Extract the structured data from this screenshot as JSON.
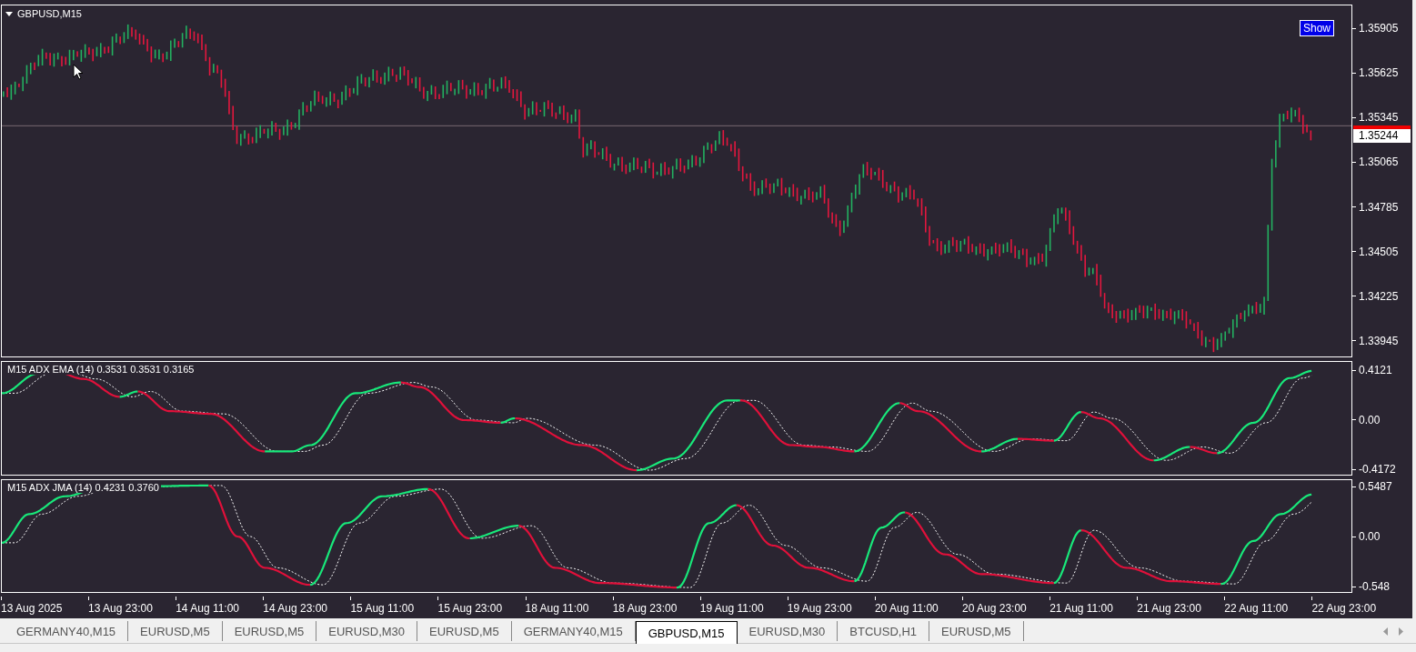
{
  "chart": {
    "title": "GBPUSD,M15",
    "show_button": "Show",
    "price_ticks": [
      "1.35905",
      "1.35625",
      "1.35345",
      "1.35065",
      "1.34785",
      "1.34505",
      "1.34225",
      "1.33945"
    ],
    "bid_label": "1.35244"
  },
  "indicators": [
    {
      "label": "M15 ADX EMA (14) 0.3531 0.3531 0.3165",
      "ticks": [
        "0.4121",
        "0.00",
        "-0.4172"
      ]
    },
    {
      "label": "M15 ADX JMA (14) 0.4231 0.3760",
      "ticks": [
        "0.5487",
        "0.00",
        "-0.548"
      ]
    }
  ],
  "time_axis": [
    "13 Aug 2025",
    "13 Aug 23:00",
    "14 Aug 11:00",
    "14 Aug 23:00",
    "15 Aug 11:00",
    "15 Aug 23:00",
    "18 Aug 11:00",
    "18 Aug 23:00",
    "19 Aug 11:00",
    "19 Aug 23:00",
    "20 Aug 11:00",
    "20 Aug 23:00",
    "21 Aug 11:00",
    "21 Aug 23:00",
    "22 Aug 11:00",
    "22 Aug 23:00"
  ],
  "tabs": [
    {
      "label": "GERMANY40,M15",
      "selected": false
    },
    {
      "label": "EURUSD,M5",
      "selected": false
    },
    {
      "label": "EURUSD,M5",
      "selected": false
    },
    {
      "label": "EURUSD,M30",
      "selected": false
    },
    {
      "label": "EURUSD,M5",
      "selected": false
    },
    {
      "label": "GERMANY40,M15",
      "selected": false
    },
    {
      "label": "GBPUSD,M15",
      "selected": true
    },
    {
      "label": "EURUSD,M30",
      "selected": false
    },
    {
      "label": "BTCUSD,H1",
      "selected": false
    },
    {
      "label": "EURUSD,M5",
      "selected": false
    }
  ]
}
